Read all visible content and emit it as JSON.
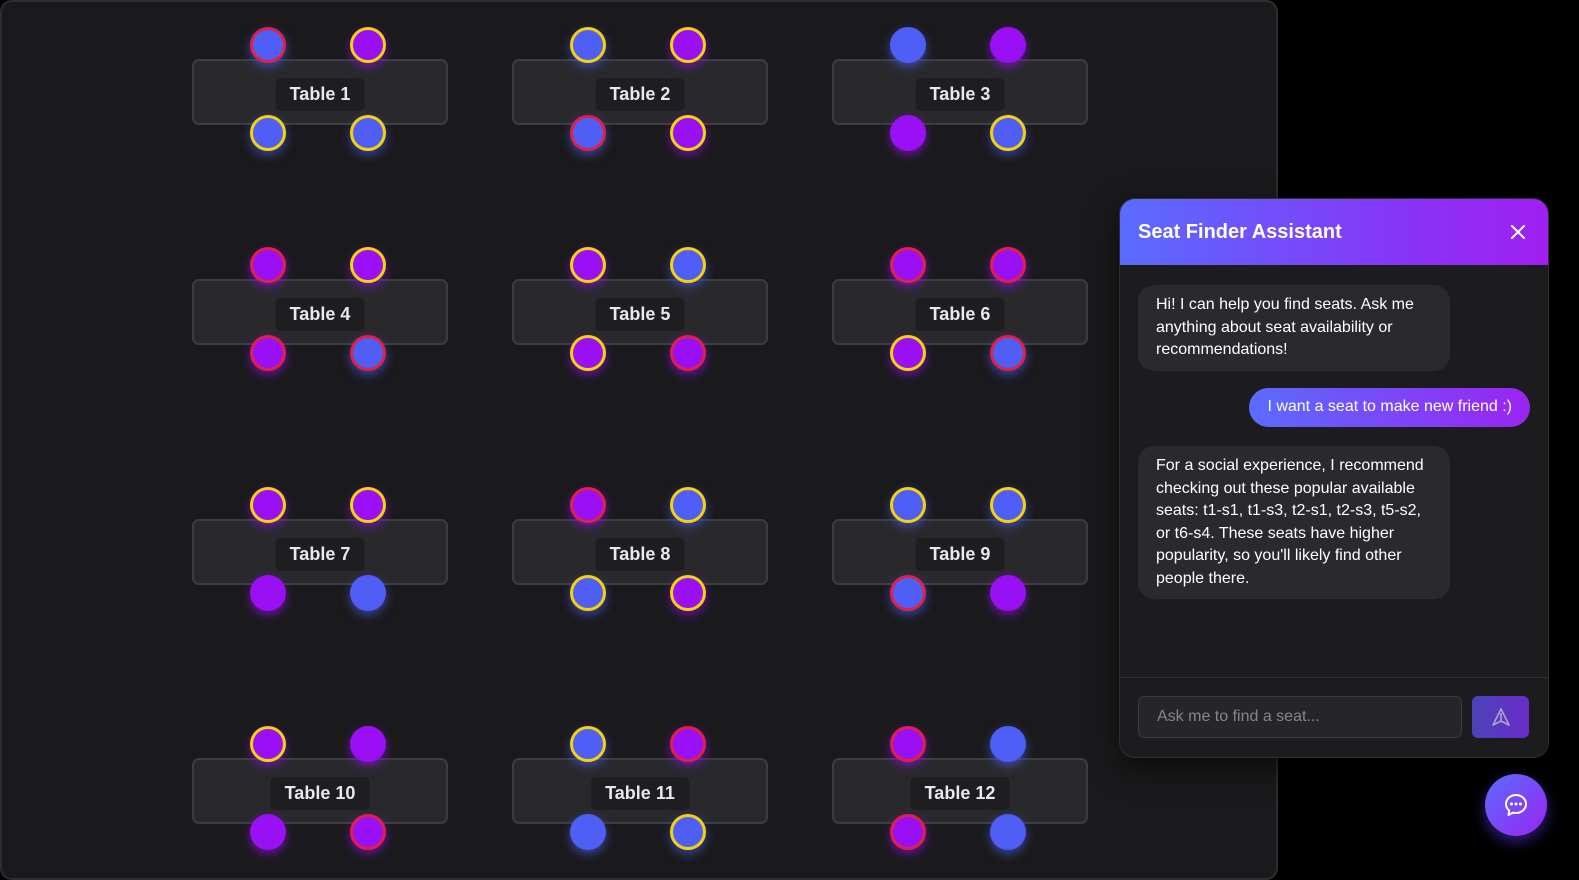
{
  "tables": [
    {
      "label": "Table 1",
      "seats": [
        {
          "color": "blue",
          "ring": "red"
        },
        {
          "color": "purple",
          "ring": "yellow"
        },
        {
          "color": "blue",
          "ring": "yellow"
        },
        {
          "color": "blue",
          "ring": "yellow"
        }
      ]
    },
    {
      "label": "Table 2",
      "seats": [
        {
          "color": "blue",
          "ring": "yellow"
        },
        {
          "color": "purple",
          "ring": "yellow"
        },
        {
          "color": "blue",
          "ring": "red"
        },
        {
          "color": "purple",
          "ring": "yellow"
        }
      ]
    },
    {
      "label": "Table 3",
      "seats": [
        {
          "color": "blue",
          "ring": "none"
        },
        {
          "color": "purple",
          "ring": "none"
        },
        {
          "color": "purple",
          "ring": "none"
        },
        {
          "color": "blue",
          "ring": "yellow"
        }
      ]
    },
    {
      "label": "Table 4",
      "seats": [
        {
          "color": "purple",
          "ring": "red"
        },
        {
          "color": "purple",
          "ring": "yellow"
        },
        {
          "color": "purple",
          "ring": "red"
        },
        {
          "color": "blue",
          "ring": "red"
        }
      ]
    },
    {
      "label": "Table 5",
      "seats": [
        {
          "color": "purple",
          "ring": "yellow"
        },
        {
          "color": "blue",
          "ring": "yellow"
        },
        {
          "color": "purple",
          "ring": "yellow"
        },
        {
          "color": "purple",
          "ring": "red"
        }
      ]
    },
    {
      "label": "Table 6",
      "seats": [
        {
          "color": "purple",
          "ring": "red"
        },
        {
          "color": "purple",
          "ring": "red"
        },
        {
          "color": "purple",
          "ring": "yellow"
        },
        {
          "color": "blue",
          "ring": "red"
        }
      ]
    },
    {
      "label": "Table 7",
      "seats": [
        {
          "color": "purple",
          "ring": "yellow"
        },
        {
          "color": "purple",
          "ring": "yellow"
        },
        {
          "color": "purple",
          "ring": "none"
        },
        {
          "color": "blue",
          "ring": "none"
        }
      ]
    },
    {
      "label": "Table 8",
      "seats": [
        {
          "color": "purple",
          "ring": "red"
        },
        {
          "color": "blue",
          "ring": "yellow"
        },
        {
          "color": "blue",
          "ring": "yellow"
        },
        {
          "color": "purple",
          "ring": "yellow"
        }
      ]
    },
    {
      "label": "Table 9",
      "seats": [
        {
          "color": "blue",
          "ring": "yellow"
        },
        {
          "color": "blue",
          "ring": "yellow"
        },
        {
          "color": "blue",
          "ring": "red"
        },
        {
          "color": "purple",
          "ring": "none"
        }
      ]
    },
    {
      "label": "Table 10",
      "seats": [
        {
          "color": "purple",
          "ring": "yellow"
        },
        {
          "color": "purple",
          "ring": "none"
        },
        {
          "color": "purple",
          "ring": "none"
        },
        {
          "color": "purple",
          "ring": "red"
        }
      ]
    },
    {
      "label": "Table 11",
      "seats": [
        {
          "color": "blue",
          "ring": "yellow"
        },
        {
          "color": "purple",
          "ring": "red"
        },
        {
          "color": "blue",
          "ring": "none"
        },
        {
          "color": "blue",
          "ring": "yellow"
        }
      ]
    },
    {
      "label": "Table 12",
      "seats": [
        {
          "color": "purple",
          "ring": "red"
        },
        {
          "color": "blue",
          "ring": "none"
        },
        {
          "color": "purple",
          "ring": "red"
        },
        {
          "color": "blue",
          "ring": "none"
        }
      ]
    }
  ],
  "chat": {
    "title": "Seat Finder Assistant",
    "messages": [
      {
        "role": "bot",
        "text": "Hi! I can help you find seats. Ask me anything about seat availability or recommendations!"
      },
      {
        "role": "user",
        "text": "I want a seat to make new friend :)"
      },
      {
        "role": "bot",
        "text": "For a social experience, I recommend checking out these popular available seats: t1-s1, t1-s3, t2-s1, t2-s3, t5-s2, or t6-s4. These seats have higher popularity, so you'll likely find other people there."
      }
    ],
    "input_placeholder": "Ask me to find a seat...",
    "input_value": "",
    "icons": {
      "close": "close-icon",
      "send": "send-icon",
      "fab": "chat-bubble-icon"
    }
  },
  "colors": {
    "seat_blue": "#4f5ff5",
    "seat_purple": "#9a10f5",
    "ring_red": "#e0204a",
    "ring_yellow": "#f4d20c",
    "accent_start": "#5a6cff",
    "accent_end": "#a01ff0"
  }
}
